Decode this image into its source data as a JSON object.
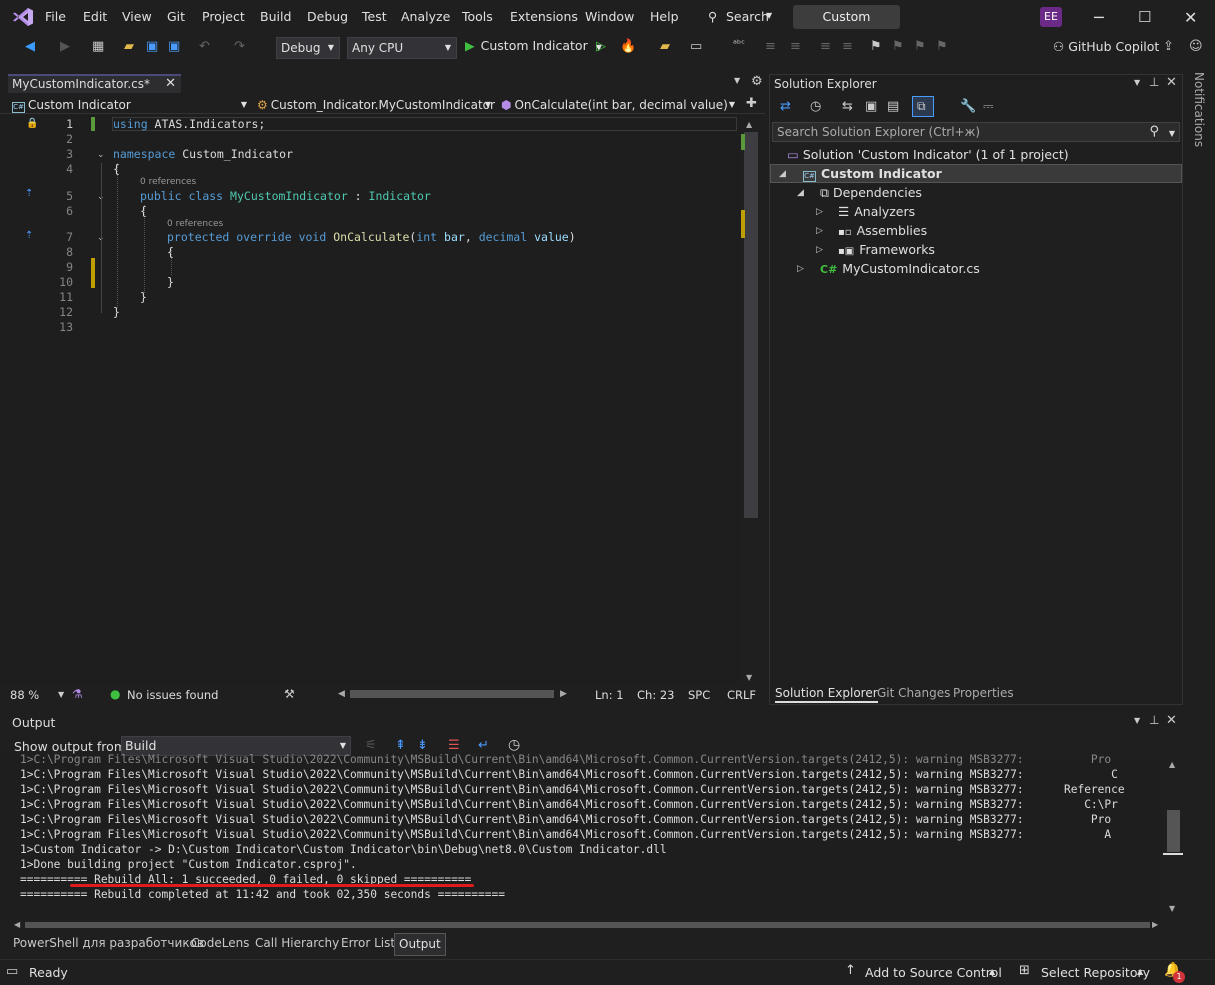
{
  "menubar": {
    "items": [
      "File",
      "Edit",
      "View",
      "Git",
      "Project",
      "Build",
      "Debug",
      "Test",
      "Analyze",
      "Tools",
      "Extensions",
      "Window",
      "Help"
    ],
    "search_label": "Search",
    "solution_title": "Custom Indicator",
    "avatar_initials": "EE"
  },
  "toolbar": {
    "configuration": "Debug",
    "platform": "Any CPU",
    "run_label": "Custom Indicator",
    "copilot_label": "GitHub Copilot"
  },
  "editor": {
    "tab_label": "MyCustomIndicator.cs*",
    "nav_project": "Custom Indicator",
    "nav_class": "Custom_Indicator.MyCustomIndicator",
    "nav_member": "OnCalculate(int bar, decimal value)",
    "line_numbers": [
      "1",
      "2",
      "3",
      "4",
      "5",
      "6",
      "7",
      "8",
      "9",
      "10",
      "11",
      "12",
      "13"
    ],
    "code": {
      "l1_kw": "using",
      "l1_rest": " ATAS.Indicators;",
      "l3_kw": "namespace",
      "l3_rest": " Custom_Indicator",
      "l4": "{",
      "refs1": "0 references",
      "l5_kw1": "public",
      "l5_kw2": "class",
      "l5_name": "MyCustomIndicator",
      "l5_colon": " : ",
      "l5_base": "Indicator",
      "l6": "{",
      "refs2": "0 references",
      "l7_kw1": "protected",
      "l7_kw2": "override",
      "l7_kw3": "void",
      "l7_fn": "OnCalculate",
      "l7_p1": "(",
      "l7_t1": "int",
      "l7_a1": "bar",
      "l7_comma": ", ",
      "l7_t2": "decimal",
      "l7_a2": "value",
      "l7_p2": ")",
      "l8": "{",
      "l10": "}",
      "l11": "}",
      "l12": "}"
    },
    "status": {
      "zoom": "88 %",
      "issues": "No issues found",
      "line": "Ln: 1",
      "col": "Ch: 23",
      "whitespace": "SPC",
      "line_ending": "CRLF"
    }
  },
  "solution_explorer": {
    "title": "Solution Explorer",
    "search_placeholder": "Search Solution Explorer (Ctrl+ж)",
    "solution": "Solution 'Custom Indicator' (1 of 1 project)",
    "project": "Custom Indicator",
    "dependencies": "Dependencies",
    "analyzers": "Analyzers",
    "assemblies": "Assemblies",
    "frameworks": "Frameworks",
    "file": "MyCustomIndicator.cs",
    "tabs": [
      "Solution Explorer",
      "Git Changes",
      "Properties"
    ],
    "notifications": "Notifications"
  },
  "output": {
    "title": "Output",
    "show_from_label": "Show output from:",
    "show_from_value": "Build",
    "lines": [
      "1>C:\\Program Files\\Microsoft Visual Studio\\2022\\Community\\MSBuild\\Current\\Bin\\amd64\\Microsoft.Common.CurrentVersion.targets(2412,5): warning MSB3277:          Pro",
      "1>C:\\Program Files\\Microsoft Visual Studio\\2022\\Community\\MSBuild\\Current\\Bin\\amd64\\Microsoft.Common.CurrentVersion.targets(2412,5): warning MSB3277:             C",
      "1>C:\\Program Files\\Microsoft Visual Studio\\2022\\Community\\MSBuild\\Current\\Bin\\amd64\\Microsoft.Common.CurrentVersion.targets(2412,5): warning MSB3277:      Reference",
      "1>C:\\Program Files\\Microsoft Visual Studio\\2022\\Community\\MSBuild\\Current\\Bin\\amd64\\Microsoft.Common.CurrentVersion.targets(2412,5): warning MSB3277:         C:\\Pr",
      "1>C:\\Program Files\\Microsoft Visual Studio\\2022\\Community\\MSBuild\\Current\\Bin\\amd64\\Microsoft.Common.CurrentVersion.targets(2412,5): warning MSB3277:          Pro",
      "1>C:\\Program Files\\Microsoft Visual Studio\\2022\\Community\\MSBuild\\Current\\Bin\\amd64\\Microsoft.Common.CurrentVersion.targets(2412,5): warning MSB3277:            A",
      "1>Custom Indicator -> D:\\Custom Indicator\\Custom Indicator\\bin\\Debug\\net8.0\\Custom Indicator.dll",
      "1>Done building project \"Custom Indicator.csproj\".",
      "========== Rebuild All: 1 succeeded, 0 failed, 0 skipped ==========",
      "========== Rebuild completed at 11:42 and took 02,350 seconds =========="
    ]
  },
  "bottom_tabs": [
    "PowerShell для разработчиков",
    "CodeLens",
    "Call Hierarchy",
    "Error List",
    "Output"
  ],
  "statusbar": {
    "ready": "Ready",
    "source_control": "Add to Source Control",
    "repository": "Select Repository",
    "notification_count": "1"
  },
  "colors": {
    "accent_underline": "#e21a1a",
    "keyword": "#569cd6",
    "type": "#4ec9b0",
    "function": "#dcdcaa",
    "param": "#9cdcfe"
  }
}
